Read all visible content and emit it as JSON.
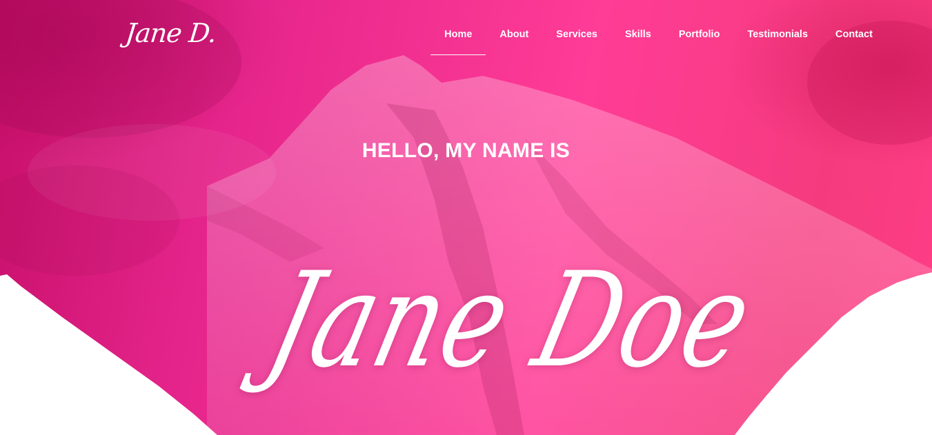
{
  "brand": {
    "logo_text": "Jane D."
  },
  "nav": {
    "items": [
      {
        "label": "Home",
        "active": true
      },
      {
        "label": "About",
        "active": false
      },
      {
        "label": "Services",
        "active": false
      },
      {
        "label": "Skills",
        "active": false
      },
      {
        "label": "Portfolio",
        "active": false
      },
      {
        "label": "Testimonials",
        "active": false
      },
      {
        "label": "Contact",
        "active": false
      }
    ]
  },
  "hero": {
    "greeting": "HELLO, MY NAME IS",
    "name": "Jane Doe"
  },
  "colors": {
    "accent": "#ff3c96",
    "accent_dark": "#c70f6a",
    "text": "#ffffff"
  }
}
